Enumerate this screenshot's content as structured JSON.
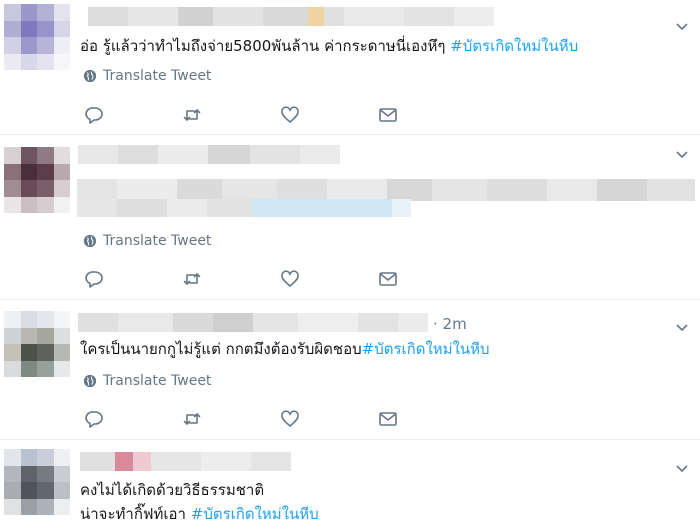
{
  "colors": {
    "link": "#1da1f2",
    "muted": "#657786",
    "text": "#14171a",
    "divider": "#e6ecf0"
  },
  "icons": {
    "caret": "chevron-down-icon",
    "globe": "globe-icon",
    "reply": "reply-icon",
    "retweet": "retweet-icon",
    "like": "heart-icon",
    "dm": "envelope-icon"
  },
  "tweets": [
    {
      "text": "อ่อ รู้แล้วว่าทำไมถึงจ่าย5800พันล้าน  ค่ากระดาษนี่เองหึๆ ",
      "hashtag": "#บัตรเกิดใหม่ในหีบ",
      "translate": "Translate Tweet"
    },
    {
      "translate": "Translate Tweet"
    },
    {
      "time": "· 2m",
      "text": "ใครเป็นนายกกูไม่รู้แต่ กกตมึงต้องรับผิดชอบ",
      "hashtag": "#บัตรเกิดใหม่ในหีบ",
      "translate": "Translate Tweet"
    },
    {
      "line1": "คงไม่ได้เกิดด้วยวิธีธรรมชาติ",
      "line2": "น่าจะทำกิ๊ฟท์เอา ",
      "hashtag": "#บัตรเกิดใหม่ในหีบ"
    }
  ]
}
